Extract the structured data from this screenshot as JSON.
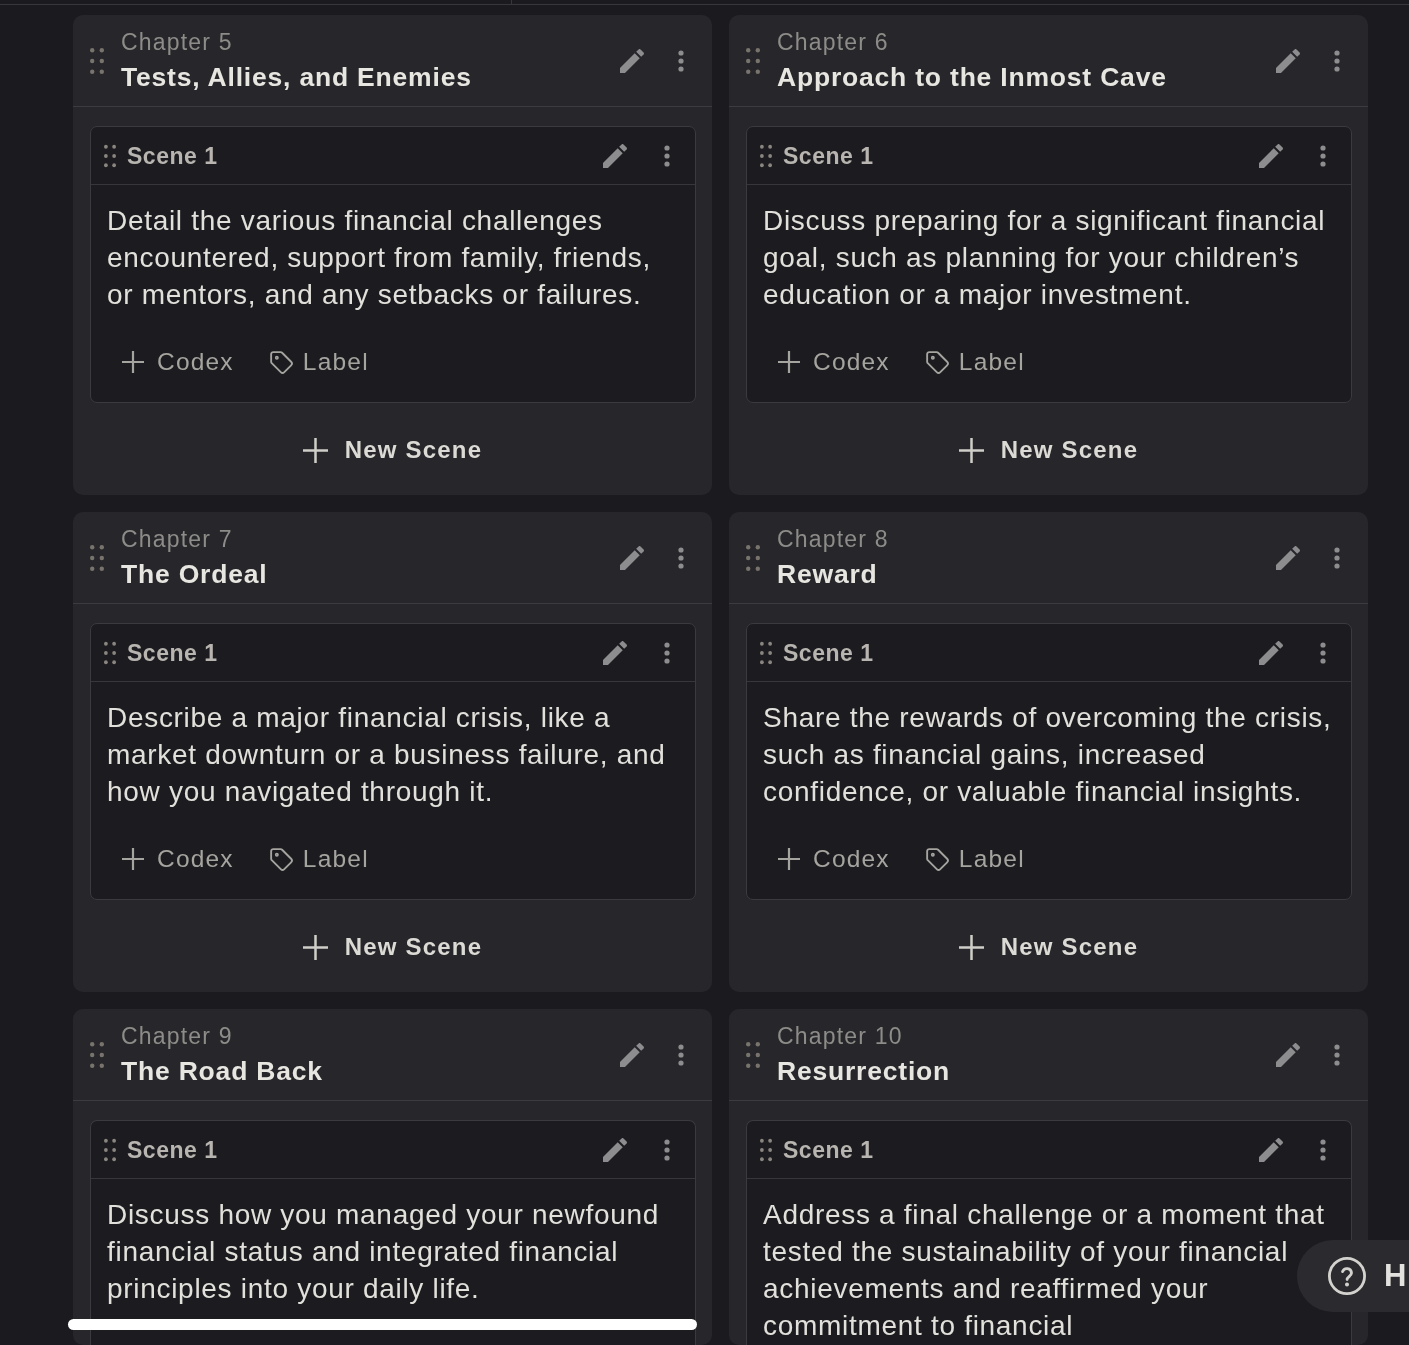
{
  "chapters": [
    {
      "number_label": "Chapter 5",
      "title": "Tests, Allies, and Enemies",
      "scenes": [
        {
          "title": "Scene 1",
          "description": "Detail the various financial challenges encountered, support from family, friends, or mentors, and any setbacks or failures.",
          "actions": [
            {
              "kind": "codex",
              "label": "Codex"
            },
            {
              "kind": "label",
              "label": "Label"
            }
          ]
        }
      ],
      "new_scene": "New Scene"
    },
    {
      "number_label": "Chapter 6",
      "title": "Approach to the Inmost Cave",
      "scenes": [
        {
          "title": "Scene 1",
          "description": "Discuss preparing for a significant financial goal, such as planning for your children’s education or a major investment.",
          "actions": [
            {
              "kind": "codex",
              "label": "Codex"
            },
            {
              "kind": "label",
              "label": "Label"
            }
          ]
        }
      ],
      "new_scene": "New Scene"
    },
    {
      "number_label": "Chapter 7",
      "title": "The Ordeal",
      "scenes": [
        {
          "title": "Scene 1",
          "description": "Describe a major financial crisis, like a market downturn or a business failure, and how you navigated through it.",
          "actions": [
            {
              "kind": "codex",
              "label": "Codex"
            },
            {
              "kind": "label",
              "label": "Label"
            }
          ]
        }
      ],
      "new_scene": "New Scene"
    },
    {
      "number_label": "Chapter 8",
      "title": "Reward",
      "scenes": [
        {
          "title": "Scene 1",
          "description": "Share the rewards of overcoming the crisis, such as financial gains, increased confidence, or valuable financial insights.",
          "actions": [
            {
              "kind": "codex",
              "label": "Codex"
            },
            {
              "kind": "label",
              "label": "Label"
            }
          ]
        }
      ],
      "new_scene": "New Scene"
    },
    {
      "number_label": "Chapter 9",
      "title": "The Road Back",
      "scenes": [
        {
          "title": "Scene 1",
          "description": "Discuss how you managed your newfound financial status and integrated financial principles into your daily life."
        }
      ]
    },
    {
      "number_label": "Chapter 10",
      "title": "Resurrection",
      "scenes": [
        {
          "title": "Scene 1",
          "description": "Address a final challenge or a moment that tested the sustainability of your financial achievements and reaffirmed your commitment to financial"
        }
      ]
    }
  ],
  "help_button": {
    "label": "H"
  }
}
